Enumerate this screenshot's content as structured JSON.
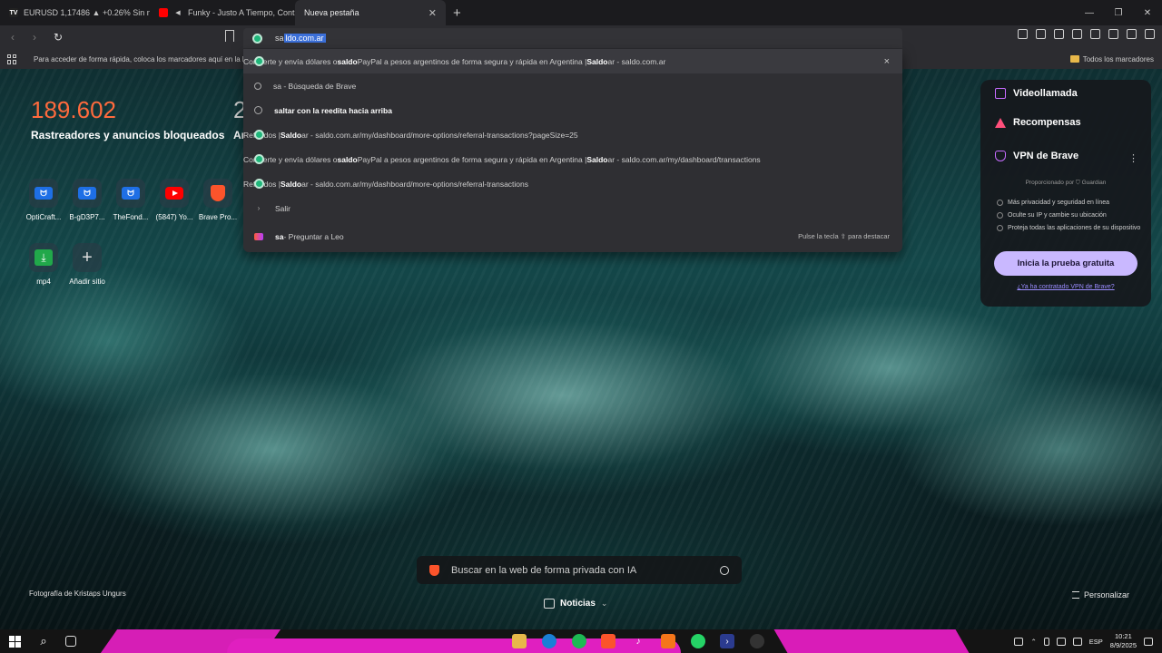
{
  "tabs": [
    {
      "title": "EURUSD 1,17486 ▲ +0.26% Sin nombre",
      "favicon": "tradingview-icon"
    },
    {
      "title": "Funky - Justo A Tiempo, Contigo",
      "favicon": "youtube-icon"
    },
    {
      "title": "Nueva pestaña",
      "favicon": "",
      "active": true
    }
  ],
  "toolbar": {
    "url_prefix": "sa",
    "url_selected": "ldo.com.ar"
  },
  "bookmarks_bar": {
    "hint": "Para acceder de forma rápida, coloca los marcadores aquí en la b",
    "all_bookmarks": "Todos los marcadores"
  },
  "suggestions": [
    {
      "icon": "site",
      "pre": "Convierte y envía dólares o ",
      "bold": "saldo",
      "post": " PayPal a pesos argentinos de forma segura y rápida en Argentina | ",
      "bold2": "Saldo",
      "post2": "ar - saldo.com.ar",
      "trail": "×"
    },
    {
      "icon": "search",
      "pre": "",
      "bold": "",
      "post": "sa - Búsqueda de Brave",
      "bold2": "",
      "post2": "",
      "trail": ""
    },
    {
      "icon": "history",
      "pre": "",
      "bold": "saltar con la reedita hacia arriba",
      "post": "",
      "bold2": "",
      "post2": "",
      "trail": ""
    },
    {
      "icon": "site",
      "pre": "Referidos | ",
      "bold": "Saldo",
      "post": "ar - saldo.com.ar/my/dashboard/more-options/referral-transactions?pageSize=25",
      "bold2": "",
      "post2": "",
      "trail": ""
    },
    {
      "icon": "site",
      "pre": "Convierte y envía dólares o ",
      "bold": "saldo",
      "post": " PayPal a pesos argentinos de forma segura y rápida en Argentina | ",
      "bold2": "Saldo",
      "post2": "ar - saldo.com.ar/my/dashboard/transactions",
      "trail": ""
    },
    {
      "icon": "site",
      "pre": "Referidos | ",
      "bold": "Saldo",
      "post": "ar - saldo.com.ar/my/dashboard/more-options/referral-transactions",
      "bold2": "",
      "post2": "",
      "trail": ""
    },
    {
      "icon": "chevron",
      "pre": "",
      "bold": "Salir",
      "post": "",
      "bold2": "",
      "post2": "",
      "trail": ""
    },
    {
      "icon": "leo",
      "pre": "",
      "bold": "sa",
      "post": " - Preguntar a Leo",
      "bold2": "",
      "post2": "",
      "trail": "Pulse la tecla ⇧ para destacar"
    }
  ],
  "stats": {
    "blocked_count": "189.602",
    "blocked_label": "Rastreadores y anuncios bloqueados",
    "second_count": "2",
    "second_label": "Ar"
  },
  "top_sites": [
    {
      "label": "OptiCraft...",
      "icon": "badge"
    },
    {
      "label": "B-gD3P7...",
      "icon": "badge"
    },
    {
      "label": "TheFond...",
      "icon": "badge"
    },
    {
      "label": "(5847) Yo...",
      "icon": "yt"
    },
    {
      "label": "Brave Pro...",
      "icon": "brave"
    },
    {
      "label": "mp4",
      "icon": "dl"
    },
    {
      "label": "Añadir sitio",
      "icon": "plus"
    }
  ],
  "brave_card": {
    "videocall": "Videollamada",
    "rewards": "Recompensas",
    "vpn": "VPN de Brave",
    "powered_by": "Proporcionado por ⛉ Guardian",
    "bullets": [
      "Más privacidad y seguridad en línea",
      "Oculte su IP y cambie su ubicación",
      "Proteja todas las aplicaciones de su dispositivo"
    ],
    "trial_button": "Inicia la prueba gratuita",
    "already_link": "¿Ya ha contratado VPN de Brave?"
  },
  "bottom": {
    "search_placeholder": "Buscar en la web de forma privada con IA",
    "news_label": "Noticias",
    "photo_credit": "Fotografía de Kristaps Ungurs",
    "customize": "Personalizar"
  },
  "taskbar": {
    "language": "ESP",
    "time": "10:21",
    "date": "8/9/2025"
  },
  "colors": {
    "accent": "#ff6a3d",
    "url_dot": "#1fb67a",
    "trial_button": "#c9b8ff",
    "taskbar_art": "#e01fc0"
  }
}
